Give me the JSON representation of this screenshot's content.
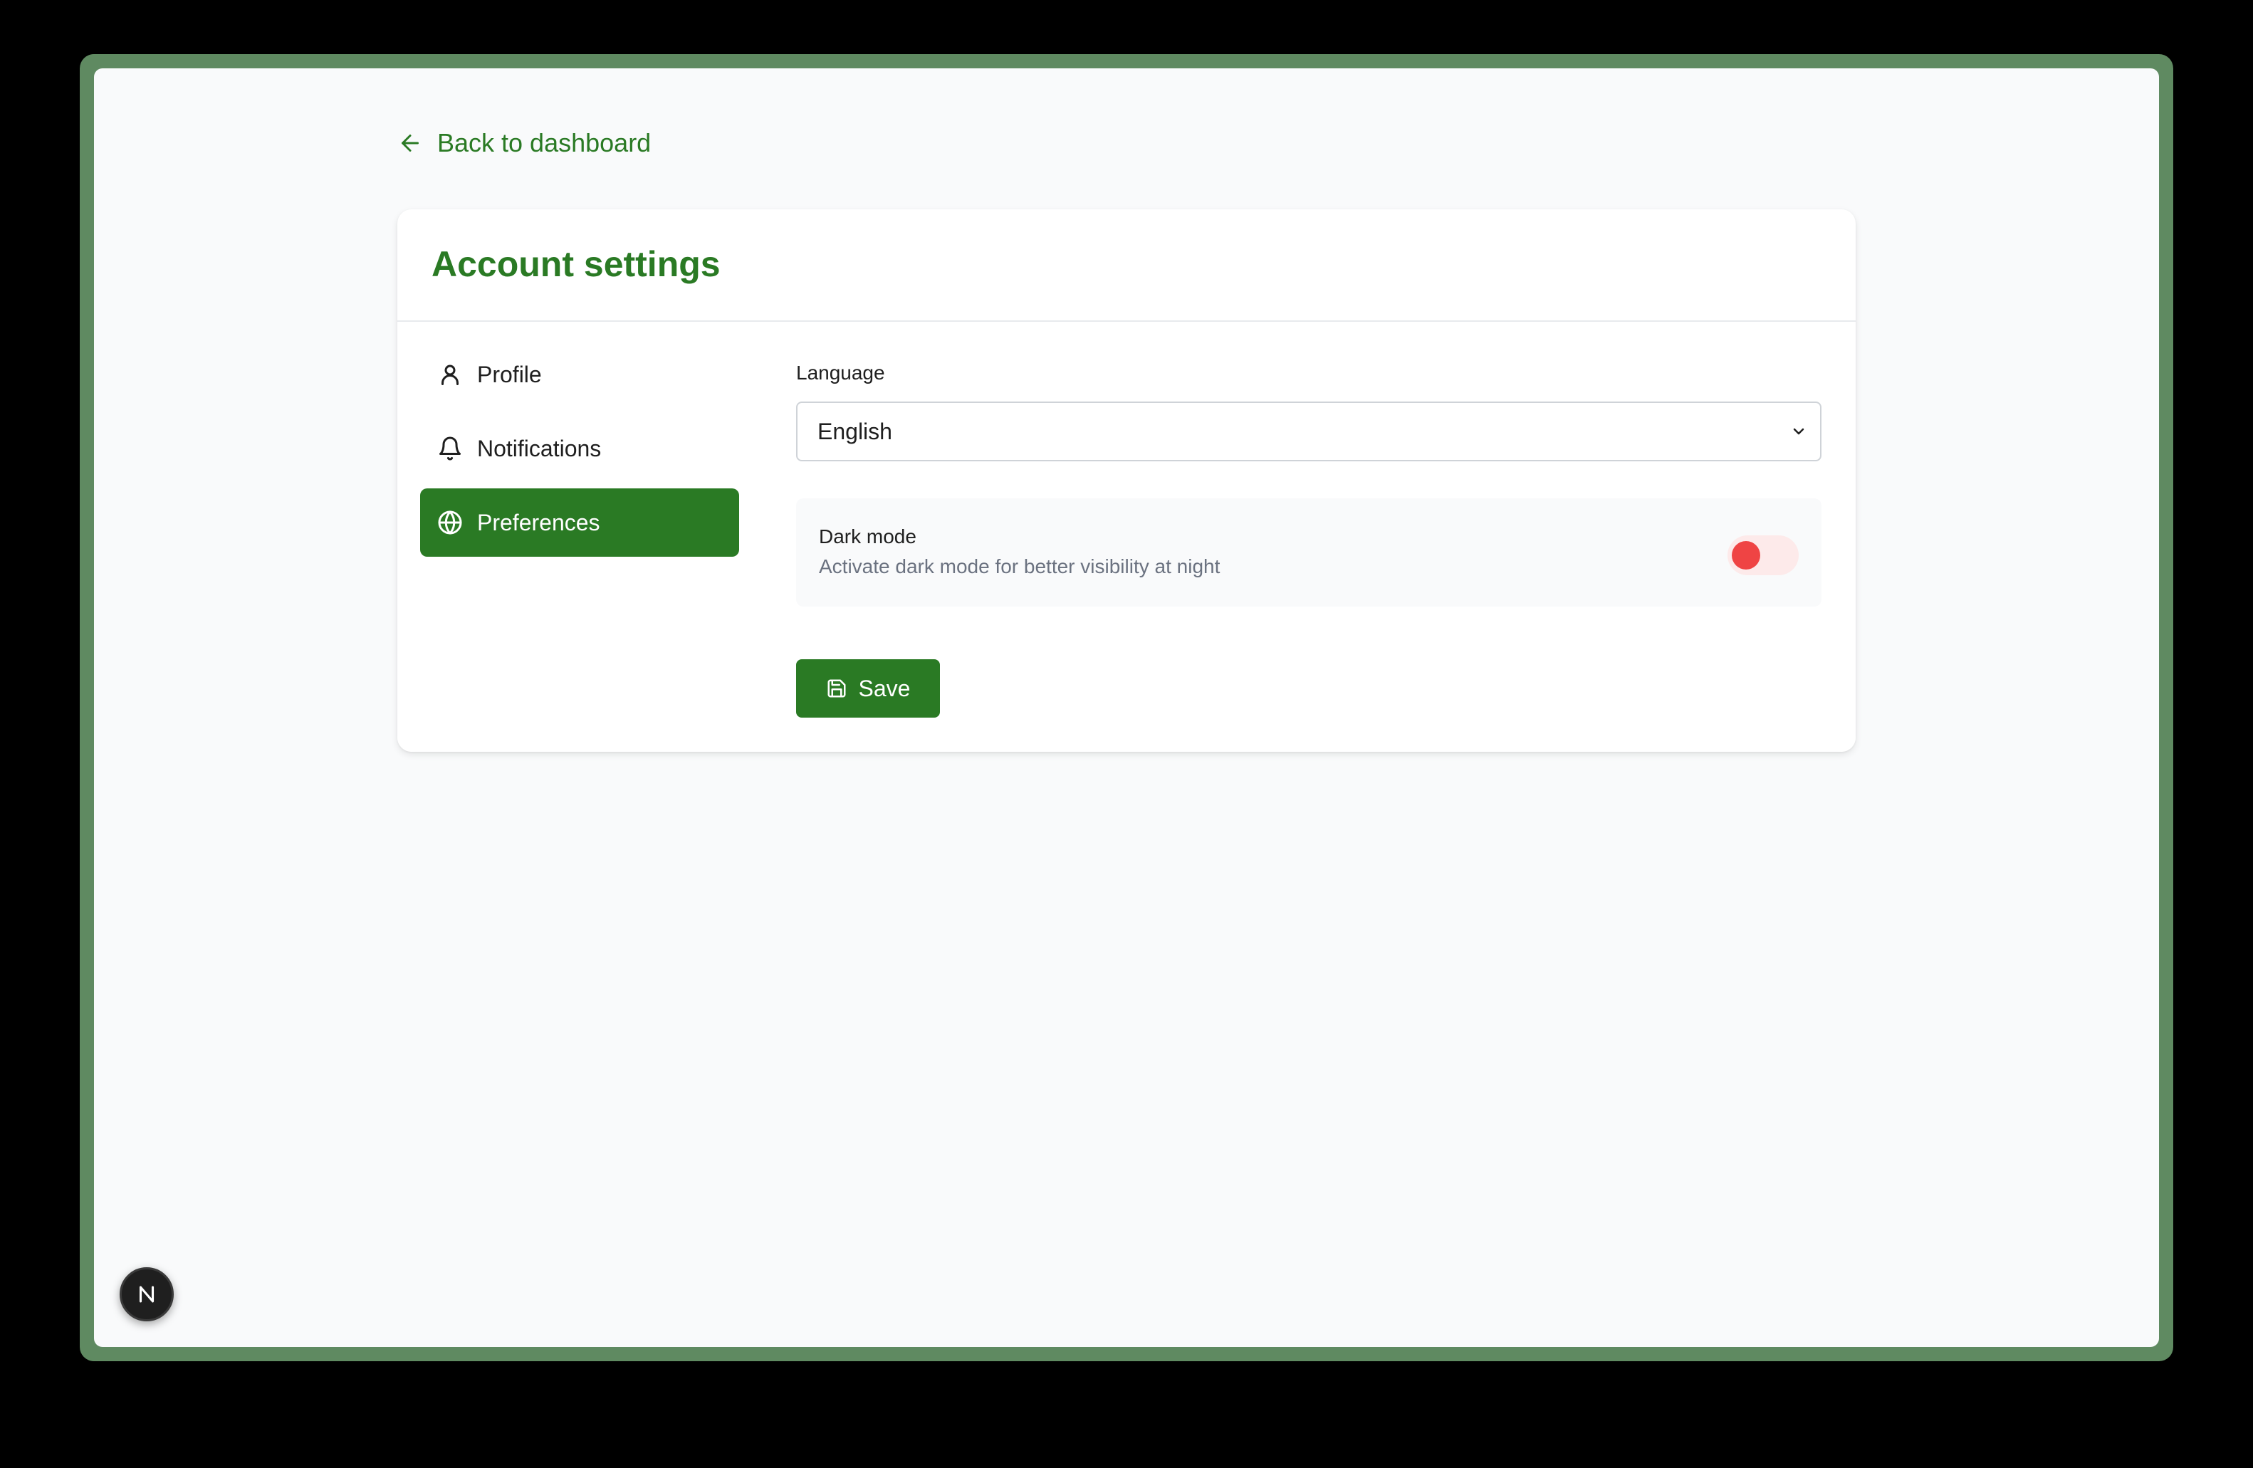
{
  "back_link": {
    "label": "Back to dashboard",
    "icon": "arrow-left-icon"
  },
  "card": {
    "title": "Account settings"
  },
  "sidebar": {
    "items": [
      {
        "label": "Profile",
        "icon": "user-icon",
        "active": false
      },
      {
        "label": "Notifications",
        "icon": "bell-icon",
        "active": false
      },
      {
        "label": "Preferences",
        "icon": "globe-icon",
        "active": true
      }
    ]
  },
  "preferences": {
    "language": {
      "label": "Language",
      "value": "English"
    },
    "dark_mode": {
      "title": "Dark mode",
      "description": "Activate dark mode for better visibility at night",
      "enabled": false,
      "knob_color": "#ef4444"
    },
    "save_label": "Save"
  },
  "colors": {
    "brand": "#2a7a24",
    "frame": "#5f8a61",
    "background": "#f9fafb"
  },
  "badge": {
    "icon": "nextjs-n-icon"
  }
}
